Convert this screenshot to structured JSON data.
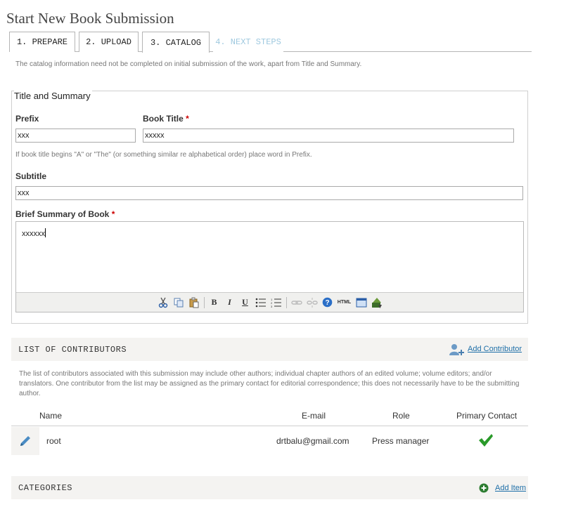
{
  "page": {
    "title": "Start New Book Submission"
  },
  "tabs": [
    {
      "label": "1. PREPARE"
    },
    {
      "label": "2. UPLOAD"
    },
    {
      "label": "3. CATALOG"
    },
    {
      "label": "4. NEXT STEPS"
    }
  ],
  "intro": "The catalog information need not be completed on initial submission of the work, apart from Title and Summary.",
  "title_summary": {
    "legend": "Title and Summary",
    "prefix": {
      "label": "Prefix",
      "value": "xxx"
    },
    "book_title": {
      "label": "Book Title",
      "required": "*",
      "value": "xxxxx"
    },
    "hint": "If book title begins \"A\" or \"The\" (or something similar re alphabetical order) place word in Prefix.",
    "subtitle": {
      "label": "Subtitle",
      "value": "xxx"
    },
    "summary": {
      "label": "Brief Summary of Book",
      "required": "*",
      "value": "xxxxxx"
    }
  },
  "editor_toolbar": {
    "icons": [
      "cut-icon",
      "copy-icon",
      "paste-icon",
      "bold-icon",
      "italic-icon",
      "underline-icon",
      "bullet-list-icon",
      "numbered-list-icon",
      "link-icon",
      "unlink-icon",
      "help-icon",
      "html-icon",
      "fullscreen-icon",
      "image-upload-icon"
    ],
    "bold": "B",
    "italic": "I",
    "underline": "U",
    "html": "HTML"
  },
  "contributors": {
    "title": "LIST OF CONTRIBUTORS",
    "add_label": "Add Contributor",
    "description": "The list of contributors associated with this submission may include other authors; individual chapter authors of an edited volume; volume editors; and/or translators. One contributor from the list may be assigned as the primary contact for editorial correspondence; this does not necessarily have to be the submitting author.",
    "columns": {
      "name": "Name",
      "email": "E-mail",
      "role": "Role",
      "primary": "Primary Contact"
    },
    "rows": [
      {
        "name": "root",
        "email": "drtbalu@gmail.com",
        "role": "Press manager",
        "primary": true
      }
    ]
  },
  "categories": {
    "title": "CATEGORIES",
    "add_label": "Add Item"
  },
  "colors": {
    "link": "#1e6fa8",
    "required": "#cc0000",
    "check": "#2a9a2a",
    "disabled_tab": "#9fc9df",
    "bar_bg": "#f4f3f1"
  }
}
